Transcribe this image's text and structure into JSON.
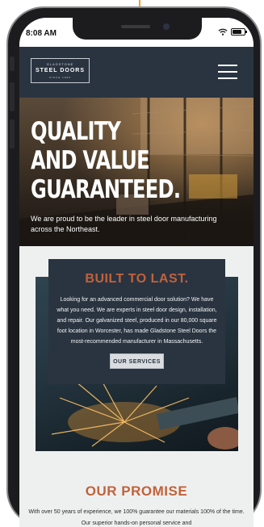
{
  "status_bar": {
    "time": "8:08 AM"
  },
  "navbar": {
    "logo": {
      "top": "GLADSTONE",
      "main": "STEEL DOORS",
      "bottom": "SINCE 1955"
    }
  },
  "hero": {
    "title_lines": [
      "QUALITY",
      "AND VALUE",
      "GUARANTEED."
    ],
    "subtitle": "We are proud to be the leader in steel door manufacturing across the Northeast."
  },
  "card": {
    "title": "BUILT TO LAST.",
    "text": "Looking for an advanced commercial door solution? We have what you need. We are experts in steel door design, installation, and repair. Our galvanized steel, produced in our 80,000 square foot location in Worcester, has made Gladstone Steel Doors the most-recommended manufacturer in Massachusetts.",
    "button_label": "OUR SERVICES"
  },
  "promise": {
    "title": "OUR PROMISE",
    "text": "With over 50 years of experience, we 100% guarantee our materials 100% of the time. Our superior hands-on personal service and"
  },
  "colors": {
    "navy": "#2a3441",
    "accent": "#c2623a",
    "pointer": "#f0a030",
    "background": "#eef0f0"
  },
  "icons": {
    "pointer": "arrow-down-icon",
    "signal": "wifi-icon",
    "battery": "battery-icon",
    "menu": "hamburger-menu-icon"
  }
}
